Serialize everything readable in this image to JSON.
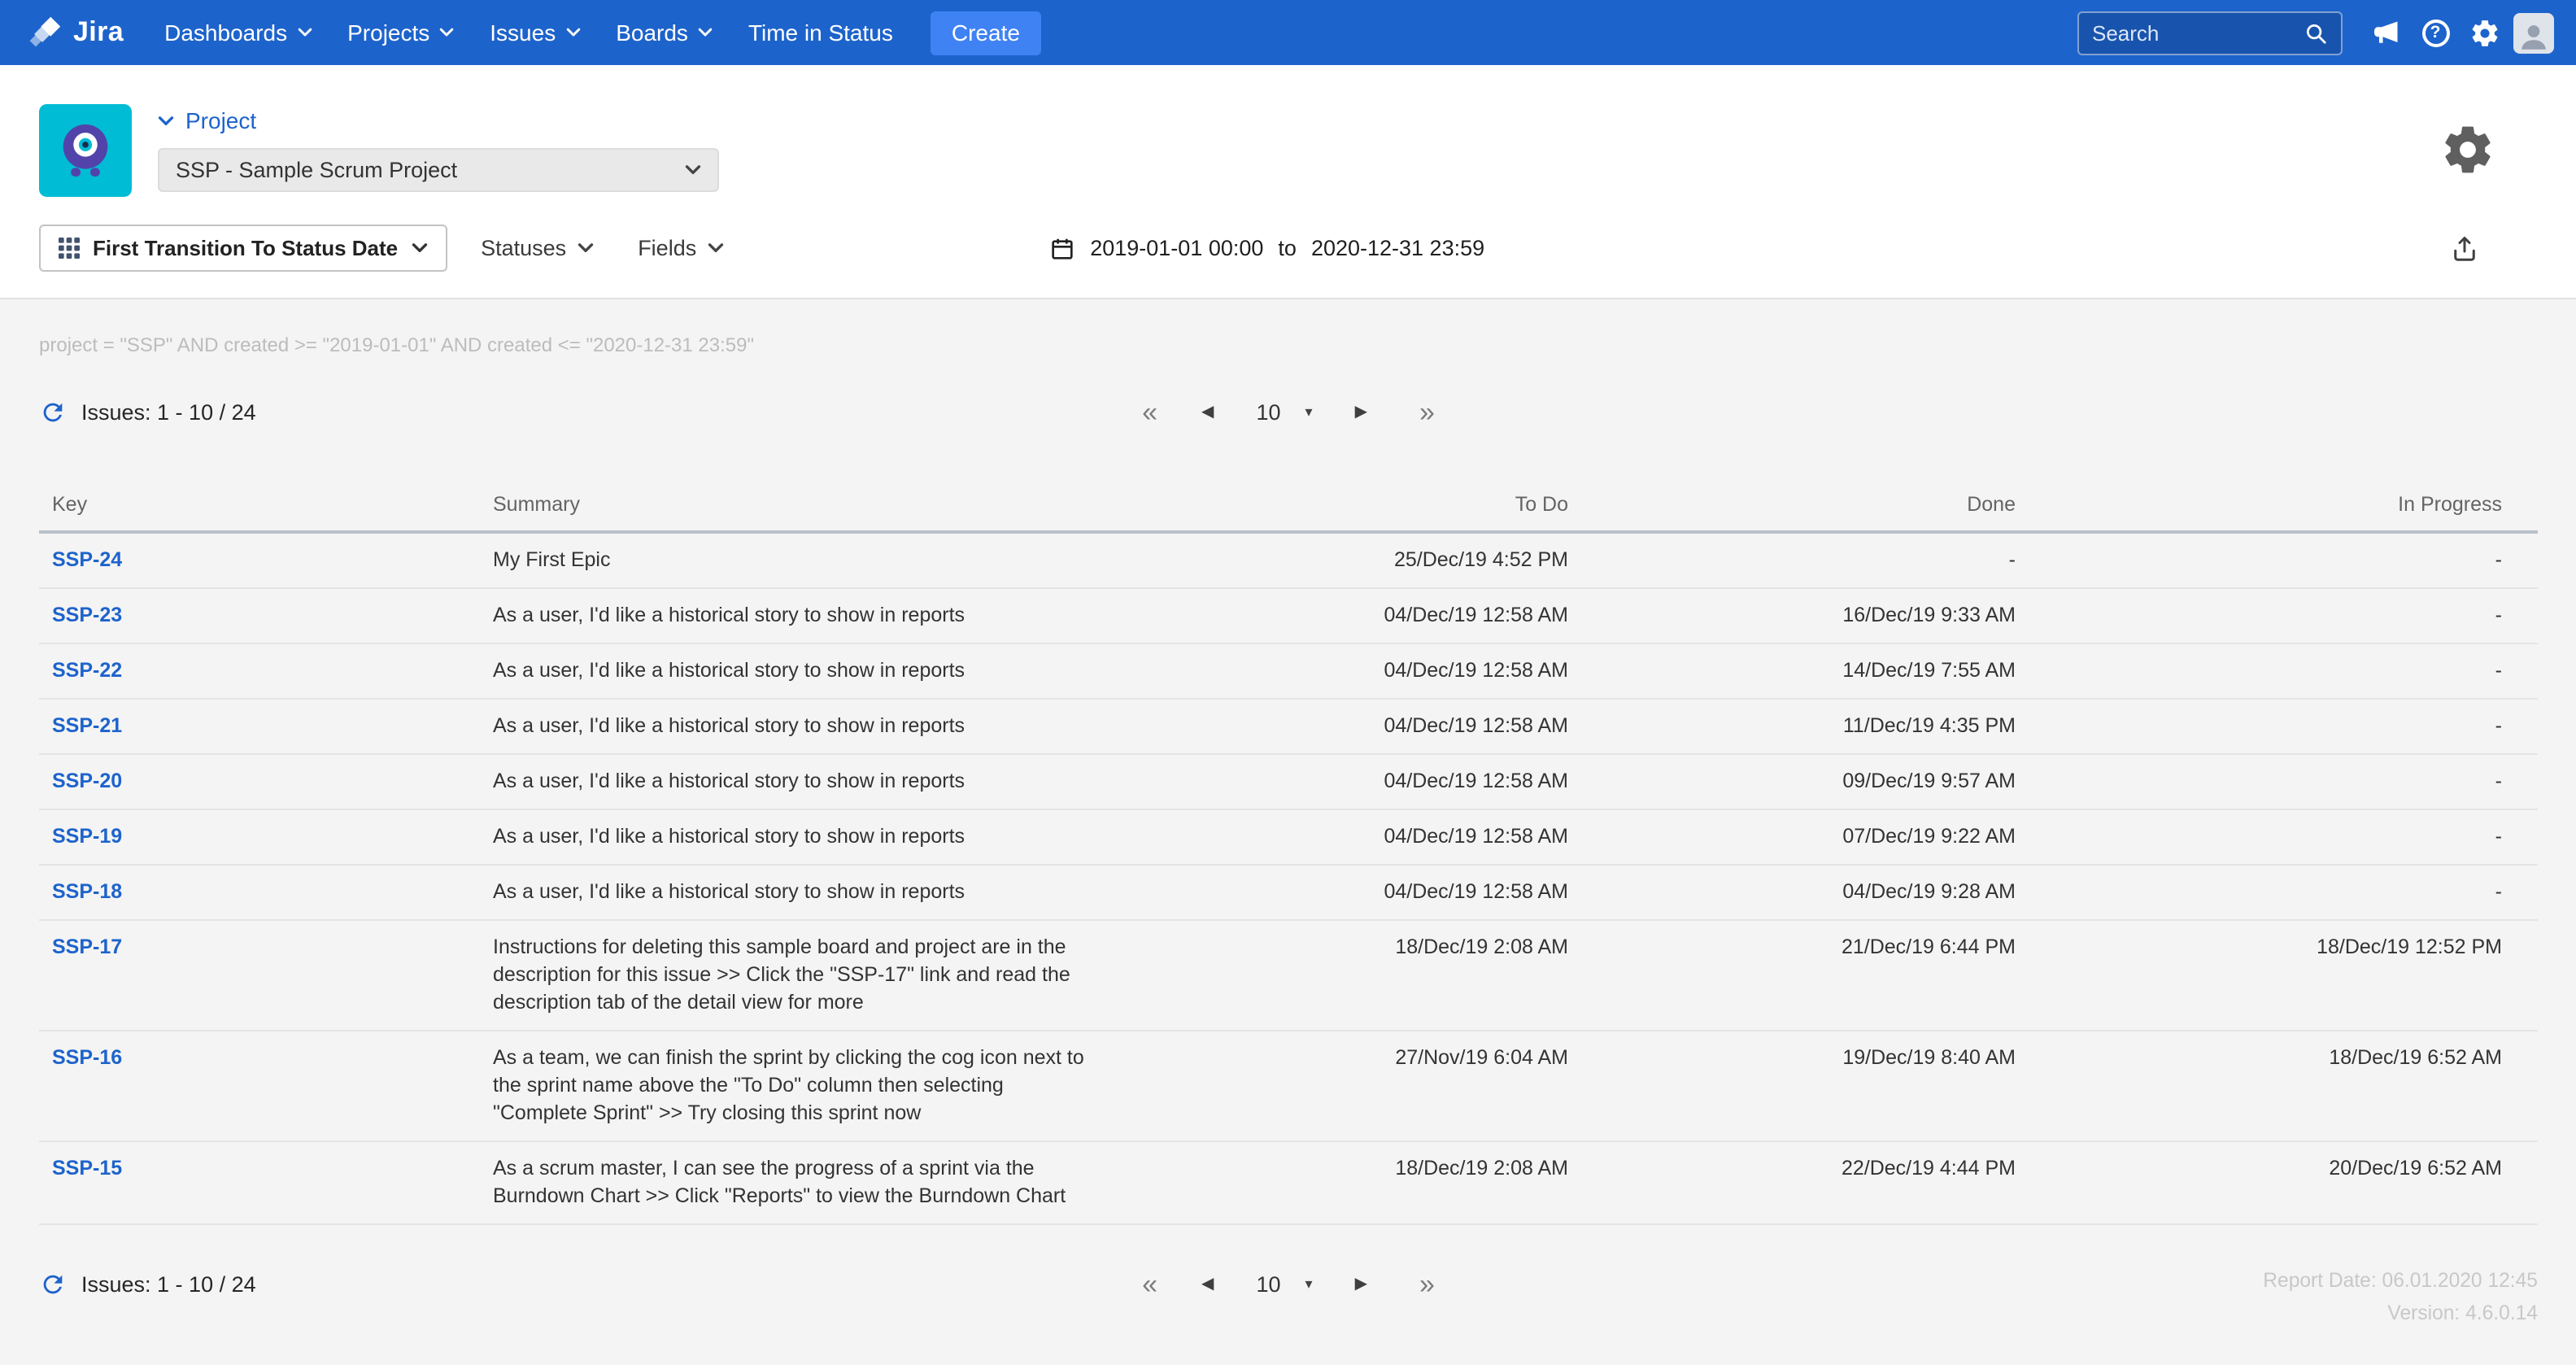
{
  "nav": {
    "brand": "Jira",
    "items": [
      {
        "label": "Dashboards"
      },
      {
        "label": "Projects"
      },
      {
        "label": "Issues"
      },
      {
        "label": "Boards"
      },
      {
        "label": "Time in Status"
      }
    ],
    "create_label": "Create",
    "search_placeholder": "Search",
    "help_glyph": "?"
  },
  "header": {
    "project_label": "Project",
    "project_select_value": "SSP - Sample Scrum Project"
  },
  "toolbar": {
    "report_type_label": "First Transition To Status Date",
    "statuses_label": "Statuses",
    "fields_label": "Fields",
    "date_from": "2019-01-01 00:00",
    "date_separator": "to",
    "date_to": "2020-12-31 23:59"
  },
  "content": {
    "jql": "project = \"SSP\" AND created >= \"2019-01-01\" AND created <= \"2020-12-31 23:59\"",
    "issues_count": "Issues: 1 - 10 / 24",
    "report_date": "Report Date: 06.01.2020 12:45",
    "version": "Version: 4.6.0.14"
  },
  "pagination": {
    "first": "«",
    "prev": "◀",
    "page_size": "10",
    "caret": "▾",
    "next": "▶",
    "last": "»"
  },
  "table": {
    "columns": [
      "Key",
      "Summary",
      "To Do",
      "Done",
      "In Progress"
    ],
    "rows": [
      {
        "key": "SSP-24",
        "summary": "My First Epic",
        "todo": "25/Dec/19 4:52 PM",
        "done": "-",
        "inprogress": "-"
      },
      {
        "key": "SSP-23",
        "summary": "As a user, I'd like a historical story to show in reports",
        "todo": "04/Dec/19 12:58 AM",
        "done": "16/Dec/19 9:33 AM",
        "inprogress": "-"
      },
      {
        "key": "SSP-22",
        "summary": "As a user, I'd like a historical story to show in reports",
        "todo": "04/Dec/19 12:58 AM",
        "done": "14/Dec/19 7:55 AM",
        "inprogress": "-"
      },
      {
        "key": "SSP-21",
        "summary": "As a user, I'd like a historical story to show in reports",
        "todo": "04/Dec/19 12:58 AM",
        "done": "11/Dec/19 4:35 PM",
        "inprogress": "-"
      },
      {
        "key": "SSP-20",
        "summary": "As a user, I'd like a historical story to show in reports",
        "todo": "04/Dec/19 12:58 AM",
        "done": "09/Dec/19 9:57 AM",
        "inprogress": "-"
      },
      {
        "key": "SSP-19",
        "summary": "As a user, I'd like a historical story to show in reports",
        "todo": "04/Dec/19 12:58 AM",
        "done": "07/Dec/19 9:22 AM",
        "inprogress": "-"
      },
      {
        "key": "SSP-18",
        "summary": "As a user, I'd like a historical story to show in reports",
        "todo": "04/Dec/19 12:58 AM",
        "done": "04/Dec/19 9:28 AM",
        "inprogress": "-"
      },
      {
        "key": "SSP-17",
        "summary": "Instructions for deleting this sample board and project are in the description for this issue >> Click the \"SSP-17\" link and read the description tab of the detail view for more",
        "todo": "18/Dec/19 2:08 AM",
        "done": "21/Dec/19 6:44 PM",
        "inprogress": "18/Dec/19 12:52 PM"
      },
      {
        "key": "SSP-16",
        "summary": "As a team, we can finish the sprint by clicking the cog icon next to the sprint name above the \"To Do\" column then selecting \"Complete Sprint\" >> Try closing this sprint now",
        "todo": "27/Nov/19 6:04 AM",
        "done": "19/Dec/19 8:40 AM",
        "inprogress": "18/Dec/19 6:52 AM"
      },
      {
        "key": "SSP-15",
        "summary": "As a scrum master, I can see the progress of a sprint via the Burndown Chart >> Click \"Reports\" to view the Burndown Chart",
        "todo": "18/Dec/19 2:08 AM",
        "done": "22/Dec/19 4:44 PM",
        "inprogress": "20/Dec/19 6:52 AM"
      }
    ]
  },
  "colors": {
    "nav_blue": "#1d63cc",
    "create_blue": "#3f82f4",
    "key_link_blue": "#1d63cc",
    "content_bg": "#f4f4f4"
  }
}
